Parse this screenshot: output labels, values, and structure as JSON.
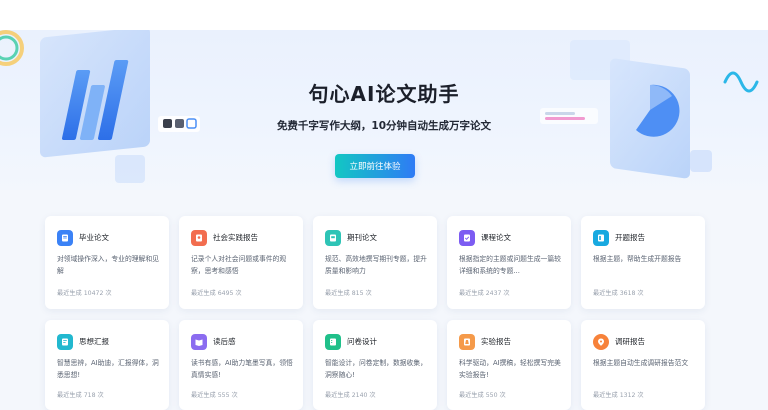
{
  "hero": {
    "title": "句心AI论文助手",
    "subtitle": "免费千字写作大纲，10分钟自动生成万字论文",
    "cta_label": "立即前往体验"
  },
  "colors": {
    "accent_from": "#12c7c3",
    "accent_to": "#2f7bf5",
    "background": "#f4f7fc"
  },
  "cards": [
    {
      "title": "毕业论文",
      "desc": "对领域操作深入，专业的理解和见解",
      "count": "最近生成 10472 次",
      "icon": "graduation-icon",
      "color": "#3b82f6"
    },
    {
      "title": "社会实践报告",
      "desc": "记录个人对社会问题或事件的观察，思考和感悟",
      "count": "最近生成 6495 次",
      "icon": "society-report-icon",
      "color": "#f26d4f"
    },
    {
      "title": "期刊论文",
      "desc": "规范、高效地撰写期刊专题，提升质量和影响力",
      "count": "最近生成 815 次",
      "icon": "journal-icon",
      "color": "#2ec4b6"
    },
    {
      "title": "课程论文",
      "desc": "根据指定的主题或问题生成一篇较详细和系统的专题...",
      "count": "最近生成 2437 次",
      "icon": "course-paper-icon",
      "color": "#7c5cf2"
    },
    {
      "title": "开题报告",
      "desc": "根据主题，帮助生成开题报告",
      "count": "最近生成 3618 次",
      "icon": "proposal-icon",
      "color": "#18a9e0"
    },
    {
      "title": "思想汇报",
      "desc": "智慧思辨，AI助迪，汇报得体，洞悉思想!",
      "count": "最近生成 718 次",
      "icon": "thought-report-icon",
      "color": "#22b8cf"
    },
    {
      "title": "读后感",
      "desc": "读书有感，AI助力笔墨写真，领悟真情实感!",
      "count": "最近生成 555 次",
      "icon": "reading-icon",
      "color": "#8b6cf0"
    },
    {
      "title": "问卷设计",
      "desc": "智能设计，问卷定制，数据收集，洞察随心!",
      "count": "最近生成 2140 次",
      "icon": "survey-icon",
      "color": "#20c08a"
    },
    {
      "title": "实验报告",
      "desc": "科学驱动，AI撰稿，轻松撰写完美实验报告!",
      "count": "最近生成 550 次",
      "icon": "lab-report-icon",
      "color": "#f59a4a"
    },
    {
      "title": "调研报告",
      "desc": "根据主题自动生成调研报告范文",
      "count": "最近生成 1312 次",
      "icon": "research-icon",
      "color": "#f7823a"
    }
  ]
}
